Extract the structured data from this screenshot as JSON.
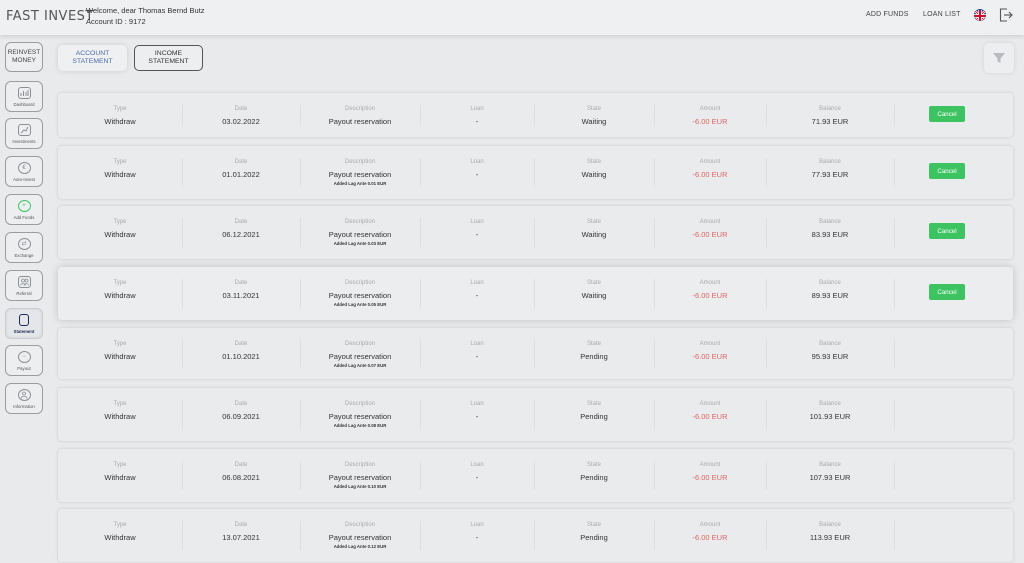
{
  "header": {
    "logo": "FAST INVEST",
    "welcome": "Welcome, dear Thomas Bernd Butz",
    "account": "Account ID : 9172",
    "add_funds": "ADD FUNDS",
    "loan_list": "LOAN LIST"
  },
  "sidebar": {
    "reinvest": "REINVEST MONEY",
    "items": [
      {
        "label": "Dashboard",
        "icon": "bar-chart-icon"
      },
      {
        "label": "Investments",
        "icon": "growth-chart-icon"
      },
      {
        "label": "Auto-Invest",
        "icon": "euro-refresh-icon"
      },
      {
        "label": "Add Funds",
        "icon": "plus-circle-icon"
      },
      {
        "label": "Exchange",
        "icon": "exchange-icon"
      },
      {
        "label": "Referral",
        "icon": "people-icon"
      },
      {
        "label": "Statement",
        "icon": "document-icon"
      },
      {
        "label": "Payout",
        "icon": "payout-icon"
      },
      {
        "label": "Information",
        "icon": "info-person-icon"
      }
    ]
  },
  "tabs": {
    "account_statement": "ACCOUNT STATEMENT",
    "income_statement": "INCOME STATEMENT"
  },
  "columns": {
    "type": "Type",
    "date": "Date",
    "description": "Description",
    "loan": "Loan",
    "state": "State",
    "amount": "Amount",
    "balance": "Balance"
  },
  "cancel_label": "Cancel",
  "rows": [
    {
      "type": "Withdraw",
      "date": "03.02.2022",
      "description": "Payout reservation",
      "sub": "",
      "loan": "-",
      "state": "Waiting",
      "amount": "-6.00 EUR",
      "balance": "71.93 EUR",
      "cancel": true
    },
    {
      "type": "Withdraw",
      "date": "01.01.2022",
      "description": "Payout reservation",
      "sub": "Added Lag Ante 0.01 EUR",
      "loan": "-",
      "state": "Waiting",
      "amount": "-6.00 EUR",
      "balance": "77.93 EUR",
      "cancel": true
    },
    {
      "type": "Withdraw",
      "date": "06.12.2021",
      "description": "Payout reservation",
      "sub": "Added Lag Ante 0.03 EUR",
      "loan": "-",
      "state": "Waiting",
      "amount": "-6.00 EUR",
      "balance": "83.93 EUR",
      "cancel": true
    },
    {
      "type": "Withdraw",
      "date": "03.11.2021",
      "description": "Payout reservation",
      "sub": "Added Lag Ante 0.05 EUR",
      "loan": "-",
      "state": "Waiting",
      "amount": "-6.00 EUR",
      "balance": "89.93 EUR",
      "cancel": true
    },
    {
      "type": "Withdraw",
      "date": "01.10.2021",
      "description": "Payout reservation",
      "sub": "Added Lag Ante 0.07 EUR",
      "loan": "-",
      "state": "Pending",
      "amount": "-6.00 EUR",
      "balance": "95.93 EUR",
      "cancel": false
    },
    {
      "type": "Withdraw",
      "date": "06.09.2021",
      "description": "Payout reservation",
      "sub": "Added Lag Ante 0.08 EUR",
      "loan": "-",
      "state": "Pending",
      "amount": "-6.00 EUR",
      "balance": "101.93 EUR",
      "cancel": false
    },
    {
      "type": "Withdraw",
      "date": "06.08.2021",
      "description": "Payout reservation",
      "sub": "Added Lag Ante 0.10 EUR",
      "loan": "-",
      "state": "Pending",
      "amount": "-6.00 EUR",
      "balance": "107.93 EUR",
      "cancel": false
    },
    {
      "type": "Withdraw",
      "date": "13.07.2021",
      "description": "Payout reservation",
      "sub": "Added Lag Ante 0.12 EUR",
      "loan": "-",
      "state": "Pending",
      "amount": "-6.00 EUR",
      "balance": "113.93 EUR",
      "cancel": false
    }
  ],
  "colors": {
    "negative_amount": "#e06464",
    "cancel_button": "#3ec362",
    "active_tab": "#4a6aa8"
  }
}
